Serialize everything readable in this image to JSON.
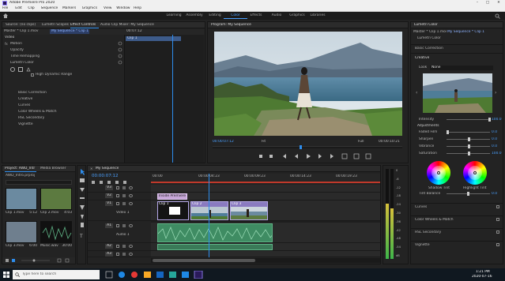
{
  "titlebar": {
    "title": "Adobe Premiere Pro 2020",
    "controls": [
      "–",
      "□",
      "✕"
    ]
  },
  "menu": [
    "File",
    "Edit",
    "Clip",
    "Sequence",
    "Markers",
    "Graphics",
    "View",
    "Window",
    "Help"
  ],
  "workspaces": {
    "items": [
      "Learning",
      "Assembly",
      "Editing",
      "Color",
      "Effects",
      "Audio",
      "Graphics",
      "Libraries"
    ],
    "active": "Color"
  },
  "top_left_panel": {
    "tabs": [
      "Source: (no clips)",
      "Lumetri Scopes",
      "Effect Controls",
      "Audio Clip Mixer: My Sequence"
    ],
    "active_tab": "Effect Controls",
    "source_label": "Master * Clip 1.mov",
    "seq_label": "My Sequence * Clip 1",
    "timecode_top": "00:07:12",
    "clip_bar_label": "Clip 1",
    "section_video": "Video",
    "effects": [
      "Motion",
      "Opacity",
      "Time Remapping",
      "Lumetri Color"
    ],
    "hdr_label": "High Dynamic Range",
    "sub_items": [
      "Basic Correction",
      "Creative",
      "Curves",
      "Color Wheels & Match",
      "HSL Secondary",
      "Vignette"
    ]
  },
  "program": {
    "tab": "Program: My Sequence",
    "timecode_left": "00:00:07:12",
    "fit": "Fit",
    "quality": "Full",
    "timecode_right": "00:00:10:21"
  },
  "lumetri": {
    "tab": "Lumetri Color",
    "master": "Master * Clip 1.mov",
    "seq": "My Sequence * Clip 1",
    "fx": "Lumetri Color",
    "basic": "Basic Correction",
    "creative": "Creative",
    "look_label": "Look",
    "look_value": "None",
    "intensity_label": "Intensity",
    "intensity_value": "100.0",
    "adjustments": "Adjustments",
    "sliders": [
      {
        "label": "Faded Film",
        "value": "0.0",
        "level": 0.0
      },
      {
        "label": "Sharpen",
        "value": "0.0",
        "level": 0.5
      },
      {
        "label": "Vibrance",
        "value": "0.0",
        "level": 0.5
      },
      {
        "label": "Saturation",
        "value": "100.0",
        "level": 0.5
      }
    ],
    "wheel_labels": [
      "Shadow Tint",
      "Highlight Tint"
    ],
    "tint_balance_label": "Tint Balance",
    "tint_balance_value": "0.0",
    "sections": [
      "Curves",
      "Color Wheels & Match",
      "HSL Secondary",
      "Vignette"
    ]
  },
  "project": {
    "tabs": [
      "Project: AWD_Intr",
      "Media Browser"
    ],
    "file": "AWD_Intro.prproj",
    "items": [
      {
        "name": "Clip 1.mov",
        "duration": "5:12"
      },
      {
        "name": "Clip 2.mov",
        "duration": "4:03"
      },
      {
        "name": "Clip 3.mov",
        "duration": "6:00"
      },
      {
        "name": "Music.wav",
        "duration": "30:00"
      }
    ]
  },
  "timeline": {
    "tab": "My Sequence",
    "timecode": "00:00:07:12",
    "ruler": [
      "00:00",
      "00:00:04:23",
      "00:00:09:23",
      "00:00:14:23",
      "00:00:19:23"
    ],
    "tracks_video": [
      "V3",
      "V2",
      "V1"
    ],
    "tracks_audio": [
      "A1",
      "A2",
      "A3"
    ],
    "track_label_v1": "Video 1",
    "track_label_a1": "Audio 1",
    "clip_labels": [
      "Clip 1",
      "Clip 2",
      "Clip 3"
    ],
    "title_clip": "Inside Premiere Pro",
    "meter_scale": [
      "0",
      "-6",
      "-12",
      "-18",
      "-24",
      "-30",
      "-36",
      "-42",
      "-48",
      "-54",
      "dB"
    ]
  },
  "taskbar": {
    "search": "Type here to search",
    "time": "1:21 PM",
    "date": "2020-07-16"
  },
  "colors": {
    "accent": "#2d8ceb",
    "purple": "#8a7bc0",
    "audio": "#3f8c63"
  }
}
